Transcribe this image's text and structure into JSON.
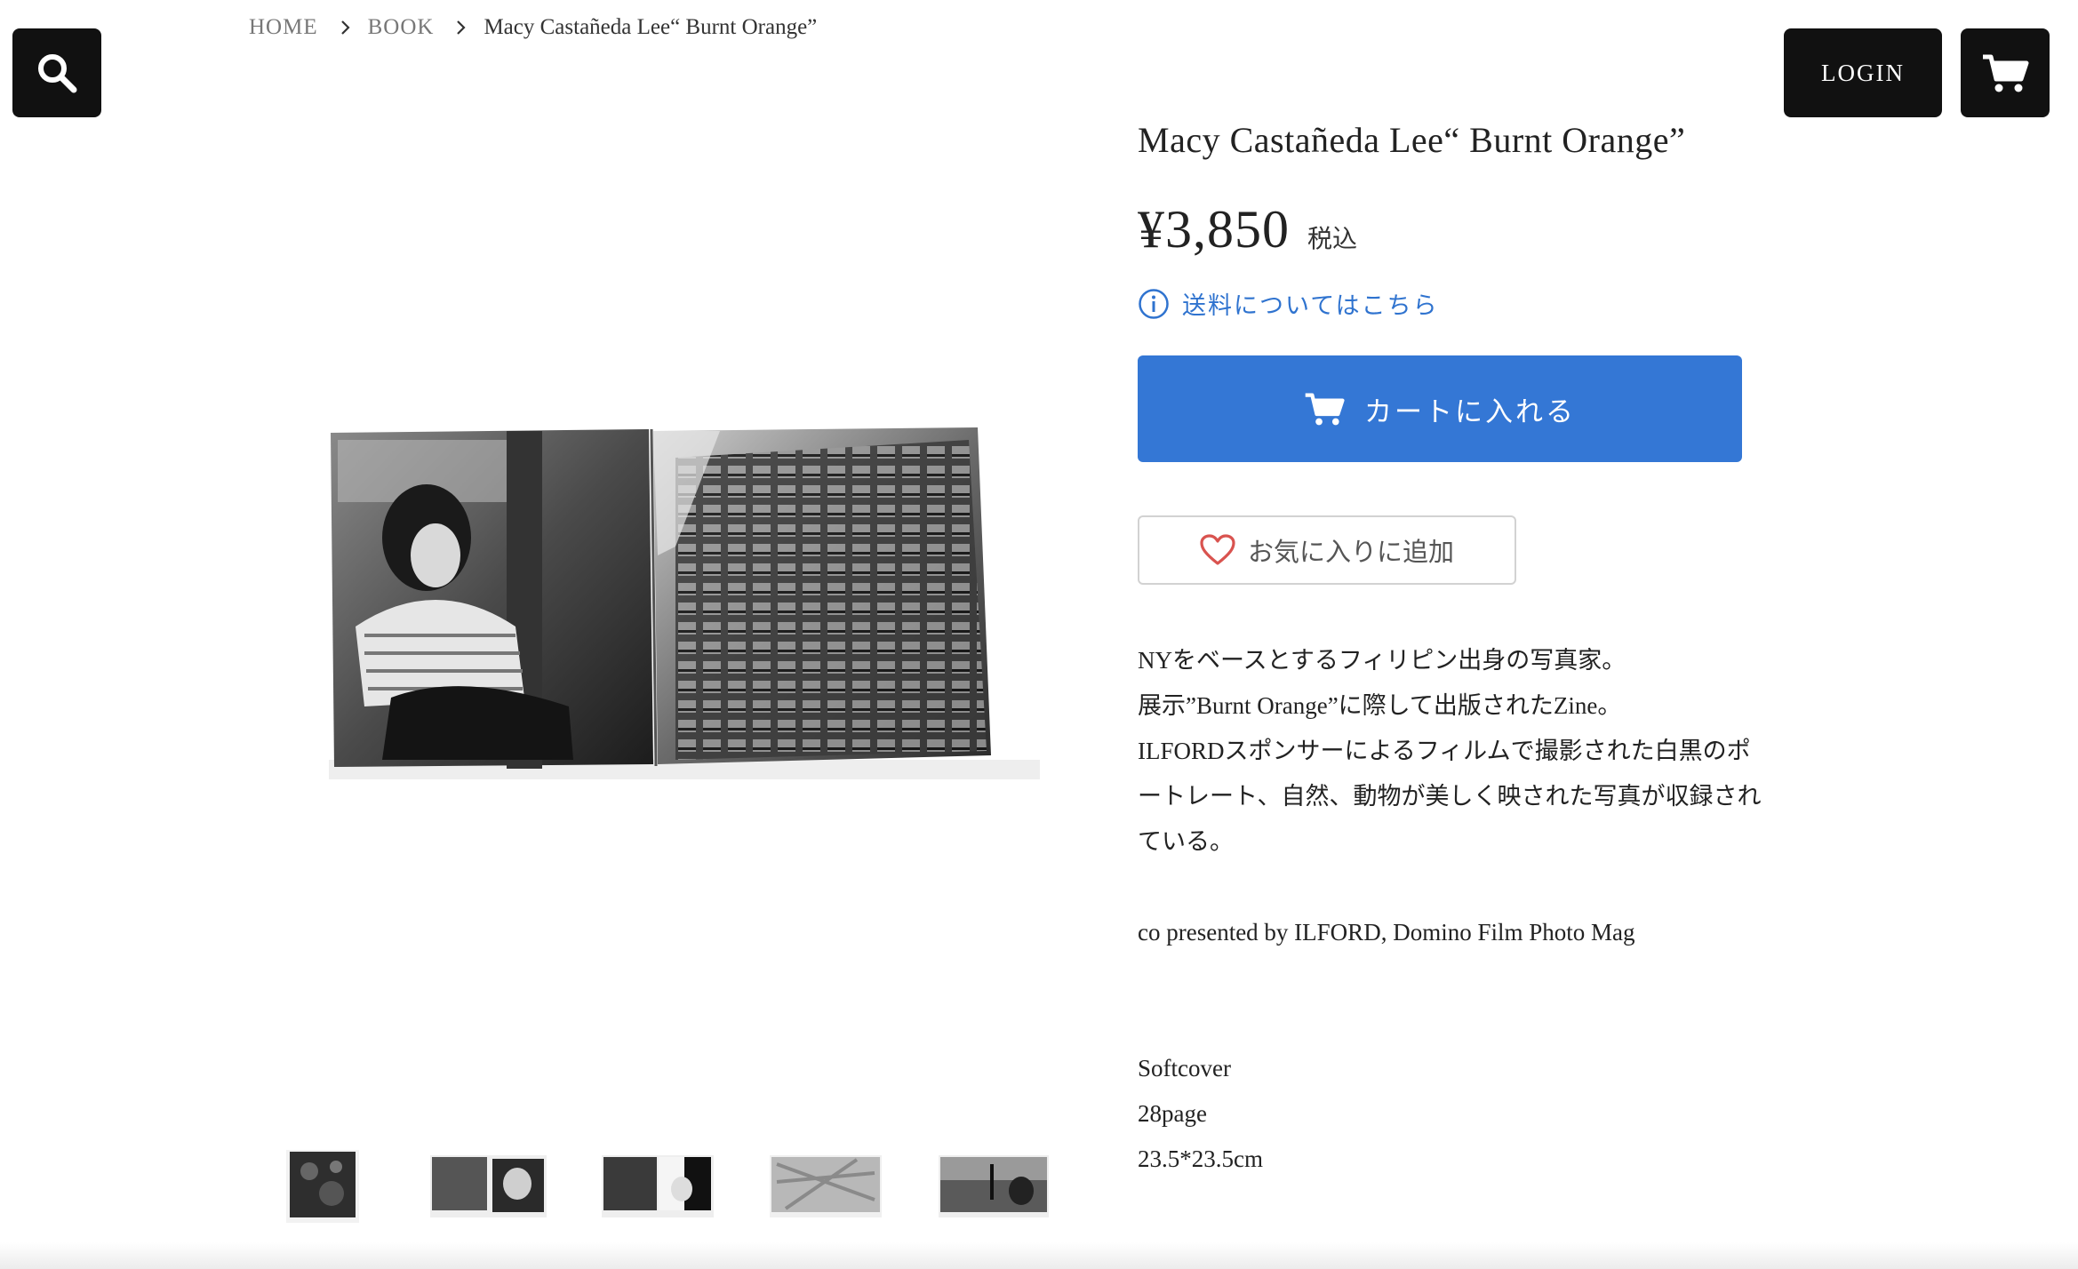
{
  "header": {
    "search_icon": "search-icon",
    "login_label": "LOGIN",
    "cart_icon": "cart-icon"
  },
  "breadcrumb": {
    "items": [
      "HOME",
      "BOOK"
    ],
    "current": "Macy Castañeda Lee“ Burnt Orange”"
  },
  "product": {
    "title": "Macy Castañeda Lee“ Burnt Orange”",
    "price": "¥3,850",
    "tax_label": "税込",
    "shipping_link": "送料についてはこちら",
    "add_to_cart": "カートに入れる",
    "favorite": "お気に入りに追加"
  },
  "description": {
    "lines": [
      "NYをベースとするフィリピン出身の写真家。",
      "展示”Burnt Orange”に際して出版されたZine。",
      "ILFORDスポンサーによるフィルムで撮影された白黒のポ",
      "ートレート、自然、動物が美しく映された写真が収録され",
      "ている。"
    ],
    "credit": "co presented by ILFORD, Domino Film Photo Mag",
    "specs": [
      "Softcover",
      "28page",
      "23.5*23.5cm"
    ]
  },
  "colors": {
    "primary_button": "#3477d5",
    "link": "#2f73cf",
    "dark_button": "#111111"
  }
}
